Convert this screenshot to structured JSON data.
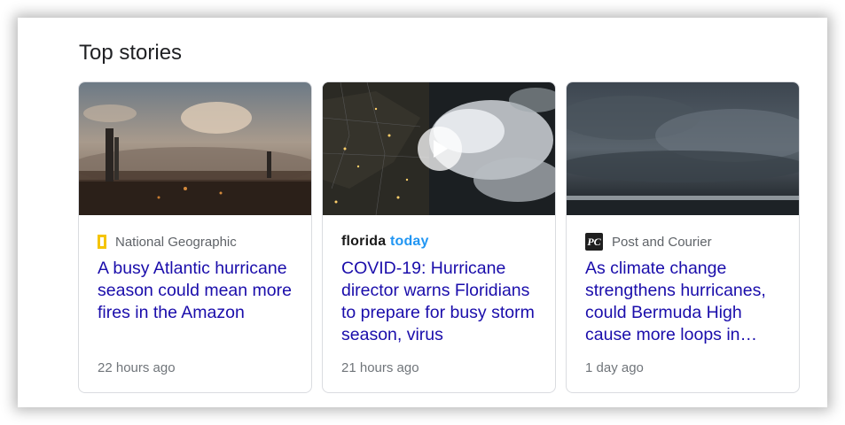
{
  "section": {
    "title": "Top stories"
  },
  "stories": [
    {
      "source": "National Geographic",
      "source_icon": "national-geographic-logo",
      "headline": "A busy Atlantic hurricane season could mean more fires in the Amazon",
      "time": "22 hours ago"
    },
    {
      "source_logo_parts": [
        "florida",
        "today"
      ],
      "source_icon": "florida-today-logo",
      "headline": "COVID-19: Hurricane director warns Floridians to prepare for busy storm season, virus",
      "time": "21 hours ago",
      "has_video": true
    },
    {
      "source": "Post and Courier",
      "source_icon": "post-and-courier-logo",
      "source_logo_text": "PC",
      "headline": "As climate change strengthens hurricanes, could Bermuda High cause more loops in…",
      "time": "1 day ago"
    }
  ],
  "colors": {
    "headline": "#1a0dab",
    "meta": "#70757a",
    "ng_yellow": "#f5c400",
    "ft_blue": "#2196f3"
  }
}
